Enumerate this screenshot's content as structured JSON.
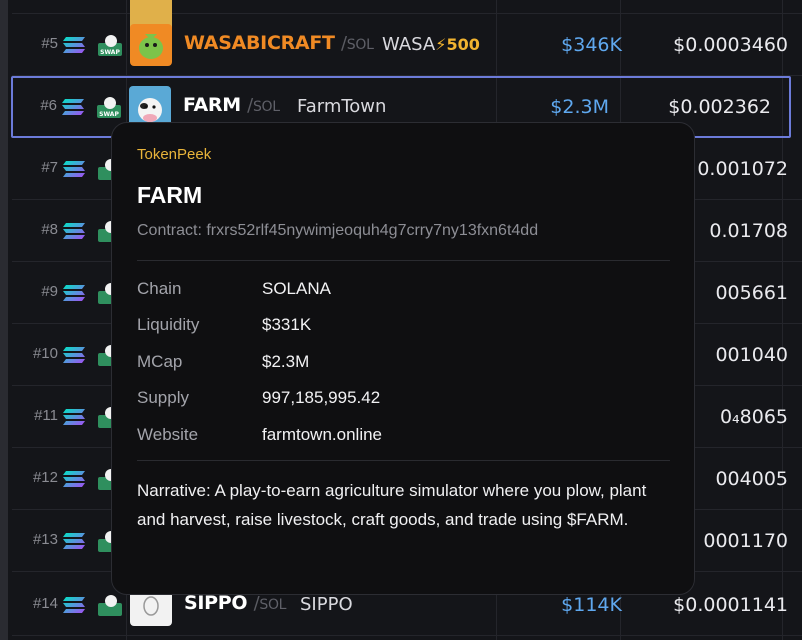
{
  "rows": [
    {
      "rank": "#5",
      "symbol": "WASABICRAFT",
      "chain": "SOL",
      "name": "WASA",
      "badge": "⚡500",
      "mcap": "$346K",
      "price": "$0.0003460",
      "symbol_color": "#f08a24"
    },
    {
      "rank": "#6",
      "symbol": "FARM",
      "chain": "SOL",
      "name": "FarmTown",
      "mcap": "$2.3M",
      "price": "$0.002362",
      "symbol_color": "#ffffff"
    },
    {
      "rank": "#7",
      "price": "0.001072"
    },
    {
      "rank": "#8",
      "price": "0.01708"
    },
    {
      "rank": "#9",
      "price": "005661"
    },
    {
      "rank": "#10",
      "price": "001040"
    },
    {
      "rank": "#11",
      "price": "0₄8065"
    },
    {
      "rank": "#12",
      "price": "004005"
    },
    {
      "rank": "#13",
      "price": "0001170"
    },
    {
      "rank": "#14",
      "symbol": "SIPPO",
      "chain": "SOL",
      "name": "SIPPO",
      "mcap": "$114K",
      "price": "$0.0001141",
      "symbol_color": "#ffffff"
    }
  ],
  "icons": {
    "chain": "solana-icon",
    "swap": "swap-icon"
  },
  "popup": {
    "brand": "TokenPeek",
    "title": "FARM",
    "contract": "Contract: frxrs52rlf45nywimjeoquh4g7crry7ny13fxn6t4dd",
    "fields": [
      {
        "key": "Chain",
        "value": "SOLANA"
      },
      {
        "key": "Liquidity",
        "value": "$331K"
      },
      {
        "key": "MCap",
        "value": "$2.3M"
      },
      {
        "key": "Supply",
        "value": "997,185,995.42"
      },
      {
        "key": "Website",
        "value": "farmtown.online"
      }
    ],
    "narrative": "Narrative: A play-to-earn agriculture simulator where you plow, plant and harvest, raise livestock, craft goods, and trade using $FARM."
  },
  "colors": {
    "accent_blue": "#5fa8ef",
    "brand_gold": "#e9b43a",
    "selection_border": "#6c7bd9"
  }
}
